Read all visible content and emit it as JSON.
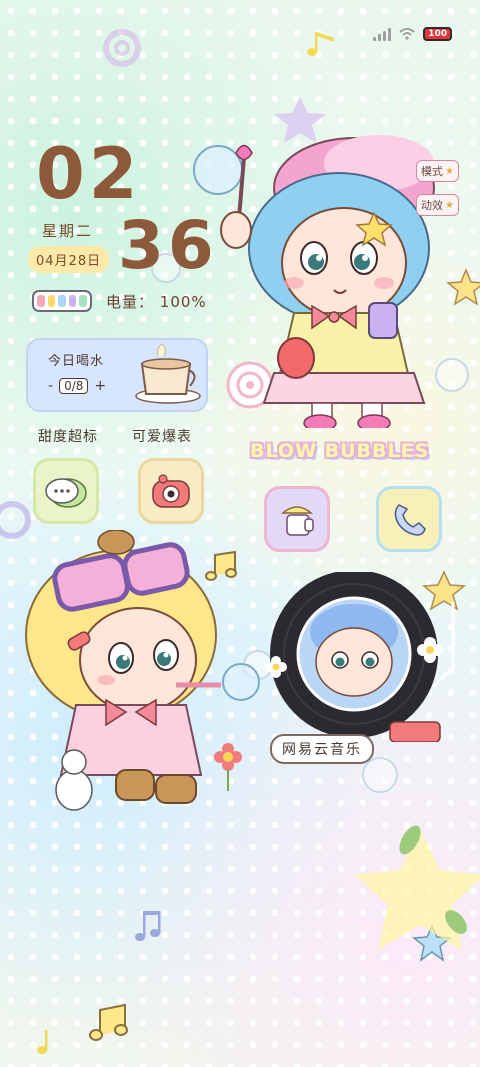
{
  "status_bar": {
    "battery_level": "100",
    "signal_icon": "signal-bars-icon",
    "wifi_icon": "wifi-icon",
    "colors": {
      "battery": "#e8343a"
    }
  },
  "clock": {
    "hour": "02",
    "minute": "36",
    "weekday": "星期二",
    "date": "04月28日"
  },
  "power": {
    "label": "电量：",
    "value": "100%"
  },
  "water_widget": {
    "title": "今日喝水",
    "minus": "-",
    "count": "0/8",
    "plus": "+",
    "icon": "teacup-icon"
  },
  "tags": {
    "left": "甜度超标",
    "right": "可爱爆表"
  },
  "side_buttons": {
    "mode": "模式",
    "action": "动效"
  },
  "banner": {
    "title": "BLOW BUBBLES"
  },
  "apps": [
    {
      "name": "chat-app",
      "icon": "chat-bubble-icon",
      "bg": "#e9f5c9"
    },
    {
      "name": "camera-app",
      "icon": "camera-icon",
      "bg": "#f7ecc4"
    },
    {
      "name": "cake-app",
      "icon": "cake-icon",
      "bg": "#e4d8f7"
    },
    {
      "name": "phone-app",
      "icon": "phone-icon",
      "bg": "#f7f0b8"
    }
  ],
  "music_widget": {
    "label": "网易云音乐",
    "icon": "vinyl-record-icon"
  },
  "colors": {
    "clock_text": "#8c5a3a",
    "date_pill": "#fde9a9",
    "water_bg": "#d7e5ff"
  }
}
